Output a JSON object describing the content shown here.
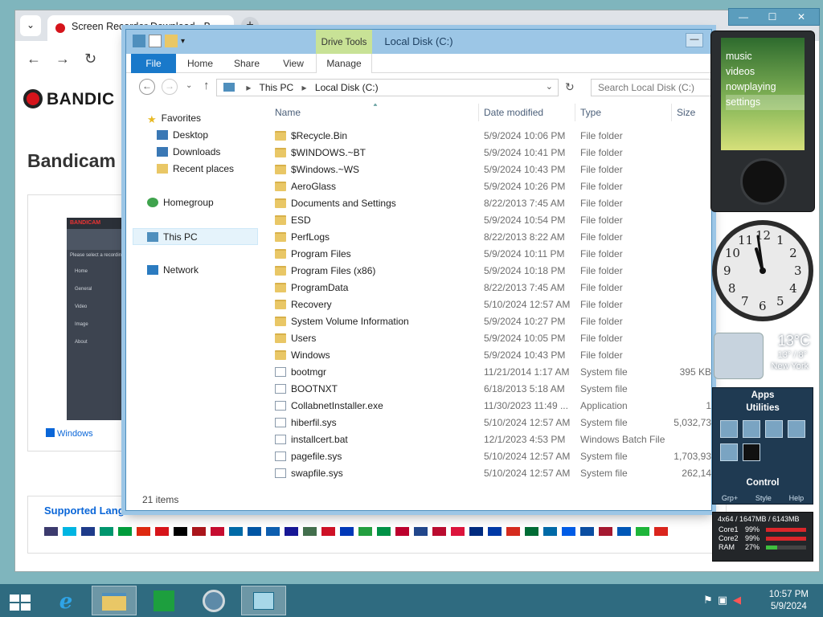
{
  "browser": {
    "tab_title": "Screen Recorder Download - B...",
    "tab_dropdown": "⌄",
    "new_tab": "+",
    "window_controls": [
      "—",
      "☐",
      "✕"
    ],
    "back": "←",
    "forward": "→",
    "reload": "↻",
    "page": {
      "logo": "BANDIC",
      "heading": "Bandicam S",
      "shot_app_title": "BANDICAM",
      "shot_menu": [
        "Home",
        "General",
        "Video",
        "Image",
        "About"
      ],
      "shot_notice": "Please select a recording",
      "shot_caption": "Windows",
      "supported_label": "Supported Langu",
      "flag_colors": [
        "#3c3b6e",
        "#00b5e2",
        "#1e3b8a",
        "#00966e",
        "#009c3b",
        "#de2910",
        "#d7141a",
        "#000000",
        "#aa151b",
        "#c60c30",
        "#006aa7",
        "#0055a4",
        "#0d5eaf",
        "#171796",
        "#436f4d",
        "#ce1126",
        "#0038b8",
        "#239f40",
        "#009246",
        "#bc002d",
        "#21468b",
        "#ba0c2f",
        "#dc143c",
        "#002b7f",
        "#0039a6",
        "#d52b1e",
        "#006c35",
        "#006aa7",
        "#005ce6",
        "#0b4ea2",
        "#a51931",
        "#0057b7",
        "#1eb53a",
        "#da251d"
      ]
    },
    "colors": {
      "accent": "#d5141b",
      "link": "#0a66d8"
    }
  },
  "explorer": {
    "title": "Local Disk (C:)",
    "context_tab": "Drive Tools",
    "minimize": "—",
    "ribbon_tabs": [
      "File",
      "Home",
      "Share",
      "View",
      "Manage"
    ],
    "nav_buttons": {
      "back": "←",
      "forward": "→",
      "recent": "⌄",
      "up": "↑"
    },
    "address": {
      "segments": [
        "This PC",
        "Local Disk (C:)"
      ],
      "refresh": "↻",
      "dropdown": "⌄"
    },
    "search_placeholder": "Search Local Disk (C:)",
    "nav_pane": {
      "favorites_label": "Favorites",
      "favorites": [
        "Desktop",
        "Downloads",
        "Recent places"
      ],
      "homegroup": "Homegroup",
      "this_pc": "This PC",
      "network": "Network"
    },
    "columns": [
      "Name",
      "Date modified",
      "Type",
      "Size"
    ],
    "files": [
      {
        "name": "$Recycle.Bin",
        "date": "5/9/2024 10:06 PM",
        "type": "File folder",
        "size": "",
        "kind": "folder"
      },
      {
        "name": "$WINDOWS.~BT",
        "date": "5/9/2024 10:41 PM",
        "type": "File folder",
        "size": "",
        "kind": "folder"
      },
      {
        "name": "$Windows.~WS",
        "date": "5/9/2024 10:43 PM",
        "type": "File folder",
        "size": "",
        "kind": "folder"
      },
      {
        "name": "AeroGlass",
        "date": "5/9/2024 10:26 PM",
        "type": "File folder",
        "size": "",
        "kind": "folder"
      },
      {
        "name": "Documents and Settings",
        "date": "8/22/2013 7:45 AM",
        "type": "File folder",
        "size": "",
        "kind": "folder"
      },
      {
        "name": "ESD",
        "date": "5/9/2024 10:54 PM",
        "type": "File folder",
        "size": "",
        "kind": "folder"
      },
      {
        "name": "PerfLogs",
        "date": "8/22/2013 8:22 AM",
        "type": "File folder",
        "size": "",
        "kind": "folder"
      },
      {
        "name": "Program Files",
        "date": "5/9/2024 10:11 PM",
        "type": "File folder",
        "size": "",
        "kind": "folder"
      },
      {
        "name": "Program Files (x86)",
        "date": "5/9/2024 10:18 PM",
        "type": "File folder",
        "size": "",
        "kind": "folder"
      },
      {
        "name": "ProgramData",
        "date": "8/22/2013 7:45 AM",
        "type": "File folder",
        "size": "",
        "kind": "folder"
      },
      {
        "name": "Recovery",
        "date": "5/10/2024 12:57 AM",
        "type": "File folder",
        "size": "",
        "kind": "folder"
      },
      {
        "name": "System Volume Information",
        "date": "5/9/2024 10:27 PM",
        "type": "File folder",
        "size": "",
        "kind": "folder"
      },
      {
        "name": "Users",
        "date": "5/9/2024 10:05 PM",
        "type": "File folder",
        "size": "",
        "kind": "folder"
      },
      {
        "name": "Windows",
        "date": "5/9/2024 10:43 PM",
        "type": "File folder",
        "size": "",
        "kind": "folder"
      },
      {
        "name": "bootmgr",
        "date": "11/21/2014 1:17 AM",
        "type": "System file",
        "size": "395 KB",
        "kind": "file"
      },
      {
        "name": "BOOTNXT",
        "date": "6/18/2013 5:18 AM",
        "type": "System file",
        "size": "",
        "kind": "file"
      },
      {
        "name": "CollabnetInstaller.exe",
        "date": "11/30/2023 11:49 ...",
        "type": "Application",
        "size": "1",
        "kind": "app"
      },
      {
        "name": "hiberfil.sys",
        "date": "5/10/2024 12:57 AM",
        "type": "System file",
        "size": "5,032,73",
        "kind": "file"
      },
      {
        "name": "installcert.bat",
        "date": "12/1/2023 4:53 PM",
        "type": "Windows Batch File",
        "size": "",
        "kind": "bat"
      },
      {
        "name": "pagefile.sys",
        "date": "5/10/2024 12:57 AM",
        "type": "System file",
        "size": "1,703,93",
        "kind": "file"
      },
      {
        "name": "swapfile.sys",
        "date": "5/10/2024 12:57 AM",
        "type": "System file",
        "size": "262,14",
        "kind": "file"
      }
    ],
    "status": "21 items"
  },
  "gadgets": {
    "top_controls": [
      "—",
      "☐",
      "✕"
    ],
    "zune_menu": [
      "music",
      "videos",
      "nowplaying",
      "settings"
    ],
    "clock_numbers": [
      "12",
      "1",
      "2",
      "3",
      "4",
      "5",
      "6",
      "7",
      "8",
      "9",
      "10",
      "11"
    ],
    "weather": {
      "temp": "13°C",
      "range": "13° / 8°",
      "city": "New York"
    },
    "apps": {
      "title": "Apps",
      "subtitle": "Utilities",
      "control": "Control",
      "footer": [
        "Grp+",
        "Style",
        "Help"
      ]
    },
    "cpu": {
      "header": "4x64 / 1647MB / 6143MB",
      "lines": [
        {
          "label": "Core1",
          "pct": "99%",
          "value": 0.99,
          "color": "#d9262a"
        },
        {
          "label": "Core2",
          "pct": "99%",
          "value": 0.99,
          "color": "#d9262a"
        },
        {
          "label": "RAM",
          "pct": "27%",
          "value": 0.27,
          "color": "#3fbf3f"
        }
      ]
    }
  },
  "taskbar": {
    "items": [
      "start",
      "internet-explorer",
      "file-explorer",
      "store",
      "remote-desktop",
      "downloads"
    ],
    "time": "10:57 PM",
    "date": "5/9/2024"
  }
}
